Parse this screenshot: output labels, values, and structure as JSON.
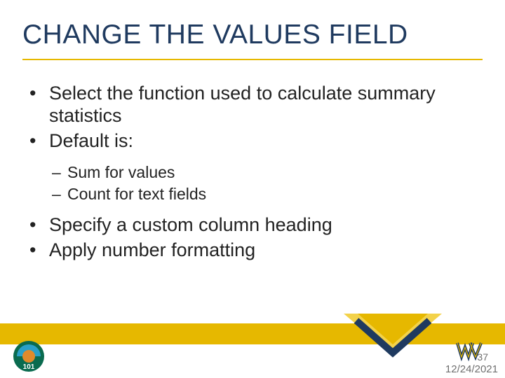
{
  "title": "CHANGE THE VALUES FIELD",
  "bullets": {
    "b1": "Select the function used to calculate summary statistics",
    "b2": "Default is:",
    "s1": "Sum for values",
    "s2": "Count for text fields",
    "b3": "Specify a custom column heading",
    "b4": "Apply number formatting"
  },
  "footer": {
    "slide_number": "37",
    "date": "12/24/2021"
  },
  "colors": {
    "title": "#1f3a5f",
    "accent": "#e6b800"
  }
}
